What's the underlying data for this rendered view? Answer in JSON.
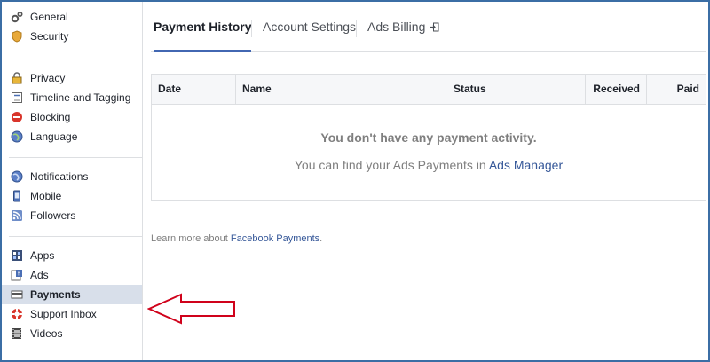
{
  "sidebar": {
    "groups": [
      [
        {
          "label": "General",
          "icon": "gears-icon"
        },
        {
          "label": "Security",
          "icon": "badge-icon"
        }
      ],
      [
        {
          "label": "Privacy",
          "icon": "lock-icon"
        },
        {
          "label": "Timeline and Tagging",
          "icon": "timeline-icon"
        },
        {
          "label": "Blocking",
          "icon": "block-icon"
        },
        {
          "label": "Language",
          "icon": "globe-icon"
        }
      ],
      [
        {
          "label": "Notifications",
          "icon": "globe-icon"
        },
        {
          "label": "Mobile",
          "icon": "phone-icon"
        },
        {
          "label": "Followers",
          "icon": "rss-icon"
        }
      ],
      [
        {
          "label": "Apps",
          "icon": "apps-icon"
        },
        {
          "label": "Ads",
          "icon": "ads-icon"
        },
        {
          "label": "Payments",
          "icon": "card-icon",
          "active": true
        },
        {
          "label": "Support Inbox",
          "icon": "lifebuoy-icon"
        },
        {
          "label": "Videos",
          "icon": "film-icon"
        }
      ]
    ]
  },
  "tabs": [
    {
      "label": "Payment History",
      "active": true
    },
    {
      "label": "Account Settings"
    },
    {
      "label": "Ads Billing",
      "icon": "external-link-icon"
    }
  ],
  "table": {
    "headers": [
      "Date",
      "Name",
      "Status",
      "Received",
      "Paid"
    ],
    "empty_title": "You don't have any payment activity.",
    "empty_sub_prefix": "You can find your Ads Payments in ",
    "empty_sub_link": "Ads Manager"
  },
  "learn_more": {
    "prefix": "Learn more about ",
    "link": "Facebook Payments",
    "suffix": "."
  },
  "colors": {
    "accent": "#4267b2",
    "link": "#365899",
    "active_bg": "#d8dfea",
    "arrow": "#d0021b",
    "frame": "#3b6ea5"
  }
}
